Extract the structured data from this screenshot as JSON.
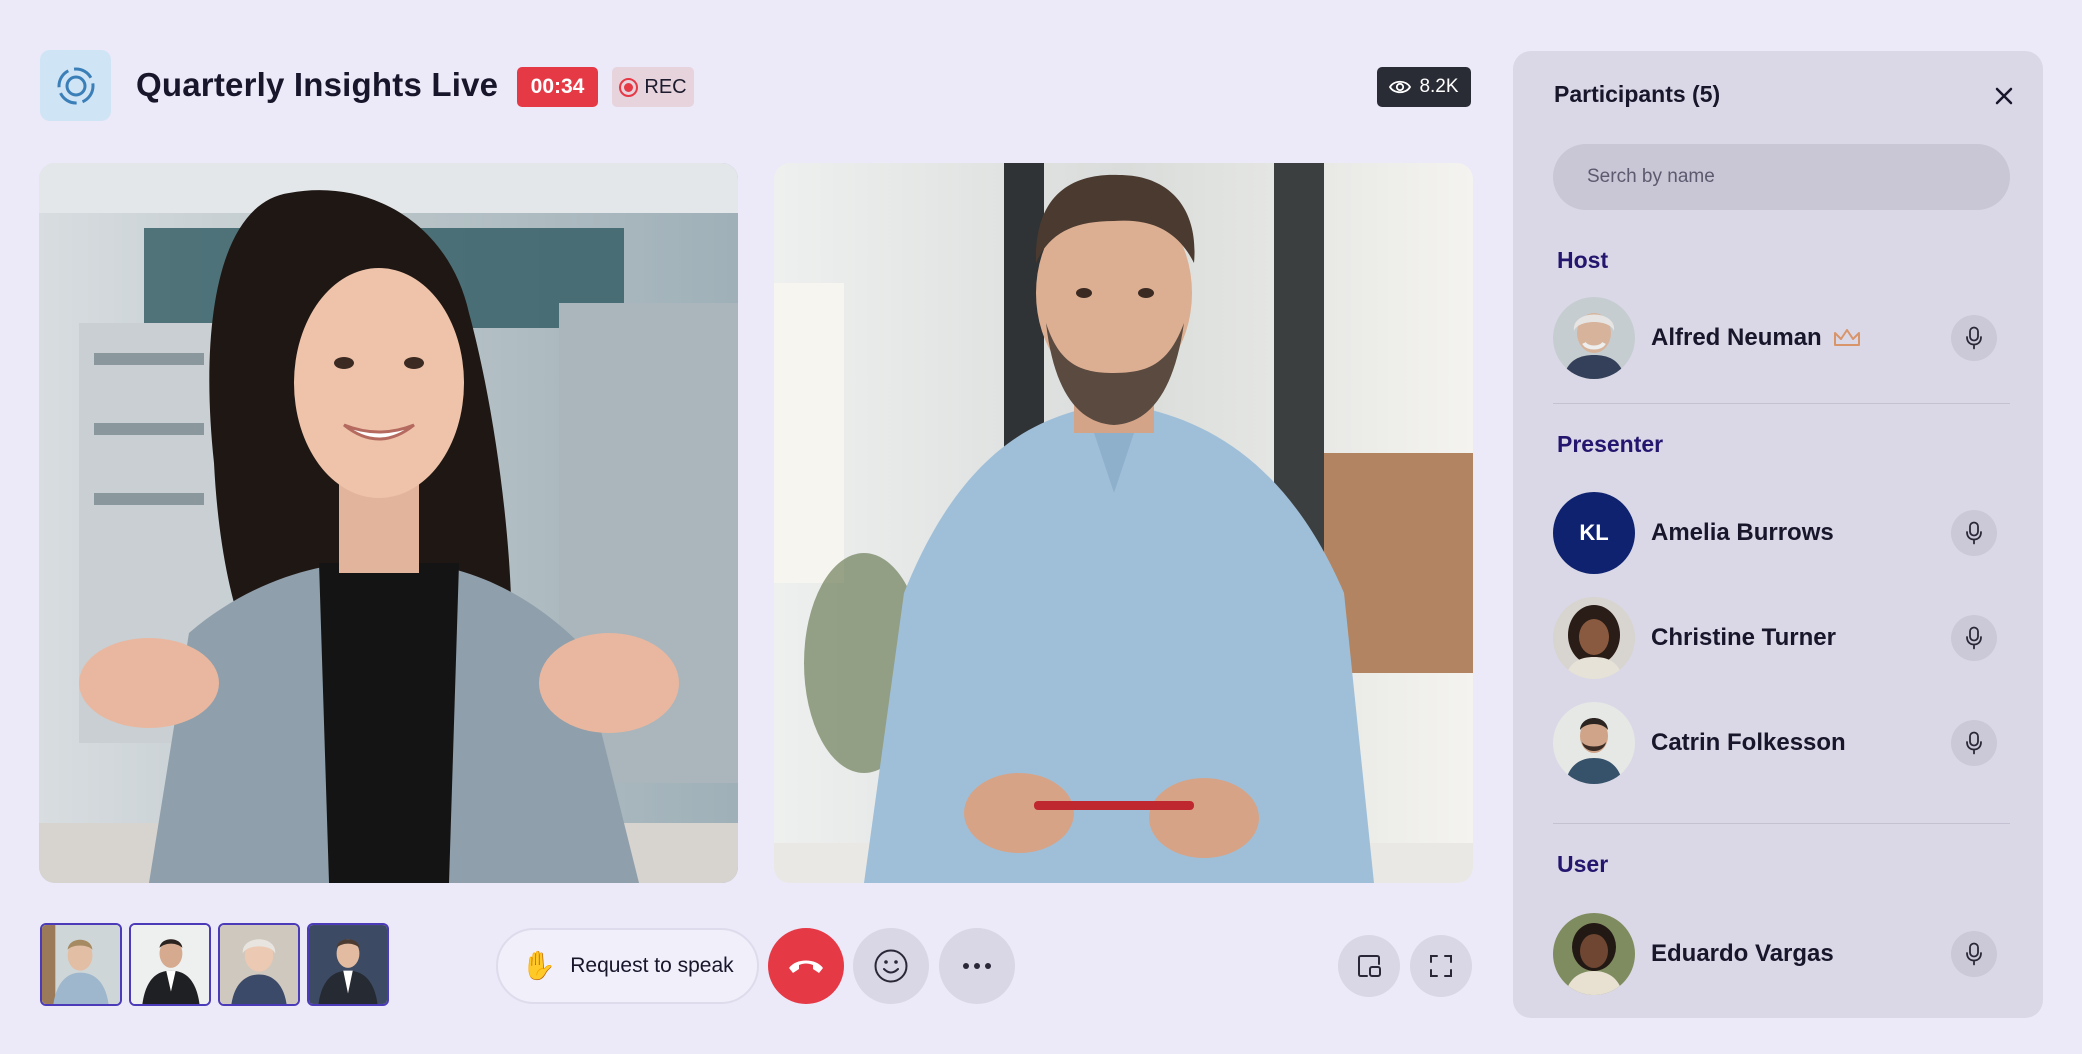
{
  "header": {
    "title": "Quarterly Insights Live",
    "timer": "00:34",
    "rec_label": "REC",
    "viewers": "8.2K"
  },
  "controls": {
    "request_label": "Request to speak"
  },
  "participants": {
    "title": "Participants (5)",
    "search_placeholder": "Serch by name",
    "host_label": "Host",
    "presenter_label": "Presenter",
    "user_label": "User",
    "host": {
      "name": "Alfred Neuman"
    },
    "presenters": [
      {
        "name": "Amelia Burrows",
        "initials": "KL"
      },
      {
        "name": "Christine Turner"
      },
      {
        "name": "Catrin Folkesson"
      }
    ],
    "users": [
      {
        "name": "Eduardo Vargas"
      }
    ]
  },
  "colors": {
    "background": "#ece9f8",
    "accent_red": "#e63946",
    "panel": "#dad8e6",
    "section_label": "#24166e",
    "initials_avatar": "#0e2270"
  },
  "icons": {
    "logo": "target-rings-icon",
    "rec": "record-dot-icon",
    "viewers": "eye-icon",
    "request": "raised-hand-icon",
    "end_call": "phone-hangup-icon",
    "reaction": "smiley-icon",
    "more": "ellipsis-icon",
    "pip": "picture-in-picture-icon",
    "fullscreen": "fullscreen-icon",
    "close": "close-icon",
    "host_badge": "crown-icon",
    "mic": "microphone-icon"
  }
}
